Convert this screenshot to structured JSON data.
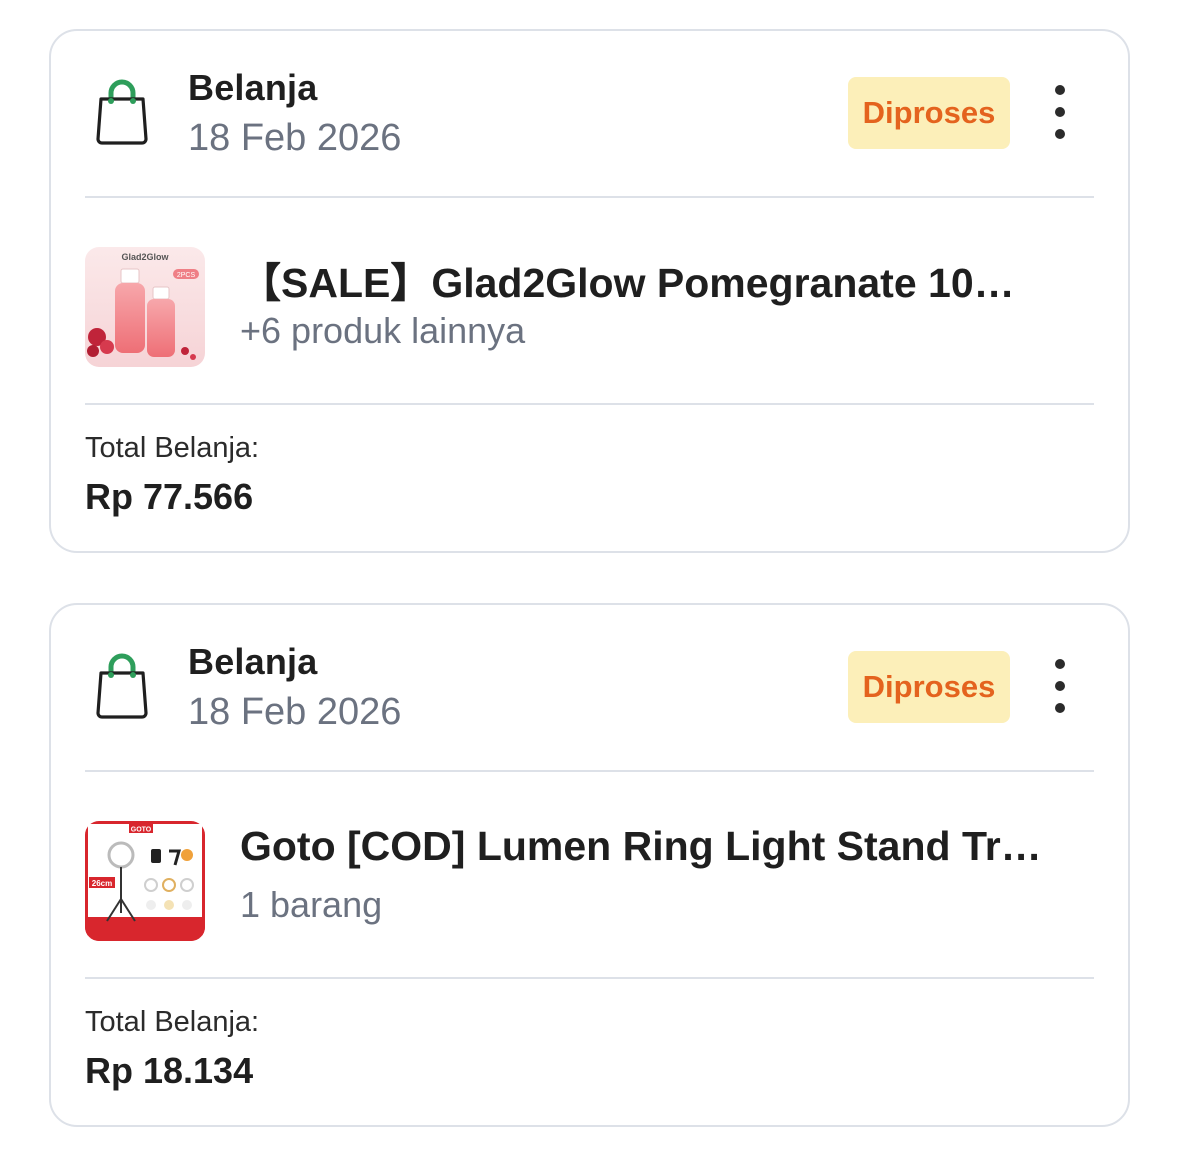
{
  "orders": [
    {
      "category": "Belanja",
      "date": "18 Feb 2026",
      "status": "Diproses",
      "product_name": "【SALE】Glad2Glow Pomegranate 10…",
      "product_sub": "+6 produk lainnya",
      "thumbnail_icon": "pomegranate-serum-product-image",
      "thumbnail_text": [
        "Glad2Glow",
        "2PCS"
      ],
      "total_label": "Total Belanja:",
      "total_value": "Rp 77.566"
    },
    {
      "category": "Belanja",
      "date": "18 Feb 2026",
      "status": "Diproses",
      "product_name": "Goto [COD] Lumen Ring Light Stand Tr…",
      "product_sub": "1 barang",
      "thumbnail_icon": "ring-light-stand-product-image",
      "thumbnail_text": [
        "GOTO",
        "26cm"
      ],
      "total_label": "Total Belanja:",
      "total_value": "Rp 18.134"
    }
  ],
  "icons": {
    "category": "shopping-bag-icon",
    "menu": "more-vertical-icon"
  },
  "colors": {
    "status_text": "#e4631e",
    "status_bg": "#fcefb9",
    "bag_handle": "#2e9e5b",
    "muted_text": "#6b7280",
    "card_border": "#dde1e8"
  }
}
